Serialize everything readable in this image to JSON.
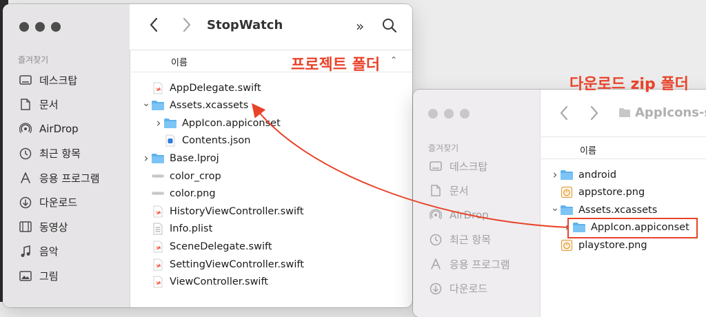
{
  "window1": {
    "title": "StopWatch",
    "favorites_label": "즐겨찾기",
    "column_header": "이름",
    "sidebar": [
      {
        "label": "데스크탑",
        "icon": "desktop-icon"
      },
      {
        "label": "문서",
        "icon": "document-icon"
      },
      {
        "label": "AirDrop",
        "icon": "airdrop-icon"
      },
      {
        "label": "최근 항목",
        "icon": "clock-icon"
      },
      {
        "label": "응용 프로그램",
        "icon": "applications-icon"
      },
      {
        "label": "다운로드",
        "icon": "download-icon"
      },
      {
        "label": "동영상",
        "icon": "film-icon"
      },
      {
        "label": "음악",
        "icon": "music-icon"
      },
      {
        "label": "그림",
        "icon": "photo-icon"
      }
    ],
    "files": [
      {
        "name": "AppDelegate.swift",
        "icon": "swift-file-icon",
        "indent": 0,
        "disclosure": ""
      },
      {
        "name": "Assets.xcassets",
        "icon": "folder-icon",
        "indent": 0,
        "disclosure": "open"
      },
      {
        "name": "AppIcon.appiconset",
        "icon": "folder-icon",
        "indent": 1,
        "disclosure": "closed"
      },
      {
        "name": "Contents.json",
        "icon": "json-file-icon",
        "indent": 1,
        "disclosure": ""
      },
      {
        "name": "Base.lproj",
        "icon": "folder-icon",
        "indent": 0,
        "disclosure": "closed"
      },
      {
        "name": "color_crop",
        "icon": "image-file-icon",
        "indent": 0,
        "disclosure": ""
      },
      {
        "name": "color.png",
        "icon": "image-file-icon",
        "indent": 0,
        "disclosure": ""
      },
      {
        "name": "HistoryViewController.swift",
        "icon": "swift-file-icon",
        "indent": 0,
        "disclosure": ""
      },
      {
        "name": "Info.plist",
        "icon": "plist-file-icon",
        "indent": 0,
        "disclosure": ""
      },
      {
        "name": "SceneDelegate.swift",
        "icon": "swift-file-icon",
        "indent": 0,
        "disclosure": ""
      },
      {
        "name": "SettingViewController.swift",
        "icon": "swift-file-icon",
        "indent": 0,
        "disclosure": ""
      },
      {
        "name": "ViewController.swift",
        "icon": "swift-file-icon",
        "indent": 0,
        "disclosure": ""
      }
    ]
  },
  "window2": {
    "title": "AppIcons-s",
    "favorites_label": "즐겨찾기",
    "column_header": "이름",
    "sidebar": [
      {
        "label": "데스크탑",
        "icon": "desktop-icon"
      },
      {
        "label": "문서",
        "icon": "document-icon"
      },
      {
        "label": "AirDrop",
        "icon": "airdrop-icon"
      },
      {
        "label": "최근 항목",
        "icon": "clock-icon"
      },
      {
        "label": "응용 프로그램",
        "icon": "applications-icon"
      },
      {
        "label": "다운로드",
        "icon": "download-icon"
      }
    ],
    "files": [
      {
        "name": "android",
        "icon": "folder-icon",
        "indent": 0,
        "disclosure": "closed"
      },
      {
        "name": "appstore.png",
        "icon": "image-file-icon",
        "indent": 0,
        "disclosure": ""
      },
      {
        "name": "Assets.xcassets",
        "icon": "folder-icon",
        "indent": 0,
        "disclosure": "open"
      },
      {
        "name": "AppIcon.appiconset",
        "icon": "folder-icon",
        "indent": 1,
        "disclosure": "closed"
      },
      {
        "name": "playstore.png",
        "icon": "image-file-icon",
        "indent": 0,
        "disclosure": ""
      }
    ]
  },
  "annotations": {
    "project_folder": "프로젝트 폴더",
    "download_folder": "다운로드 zip 폴더",
    "color": "#e8432a"
  }
}
